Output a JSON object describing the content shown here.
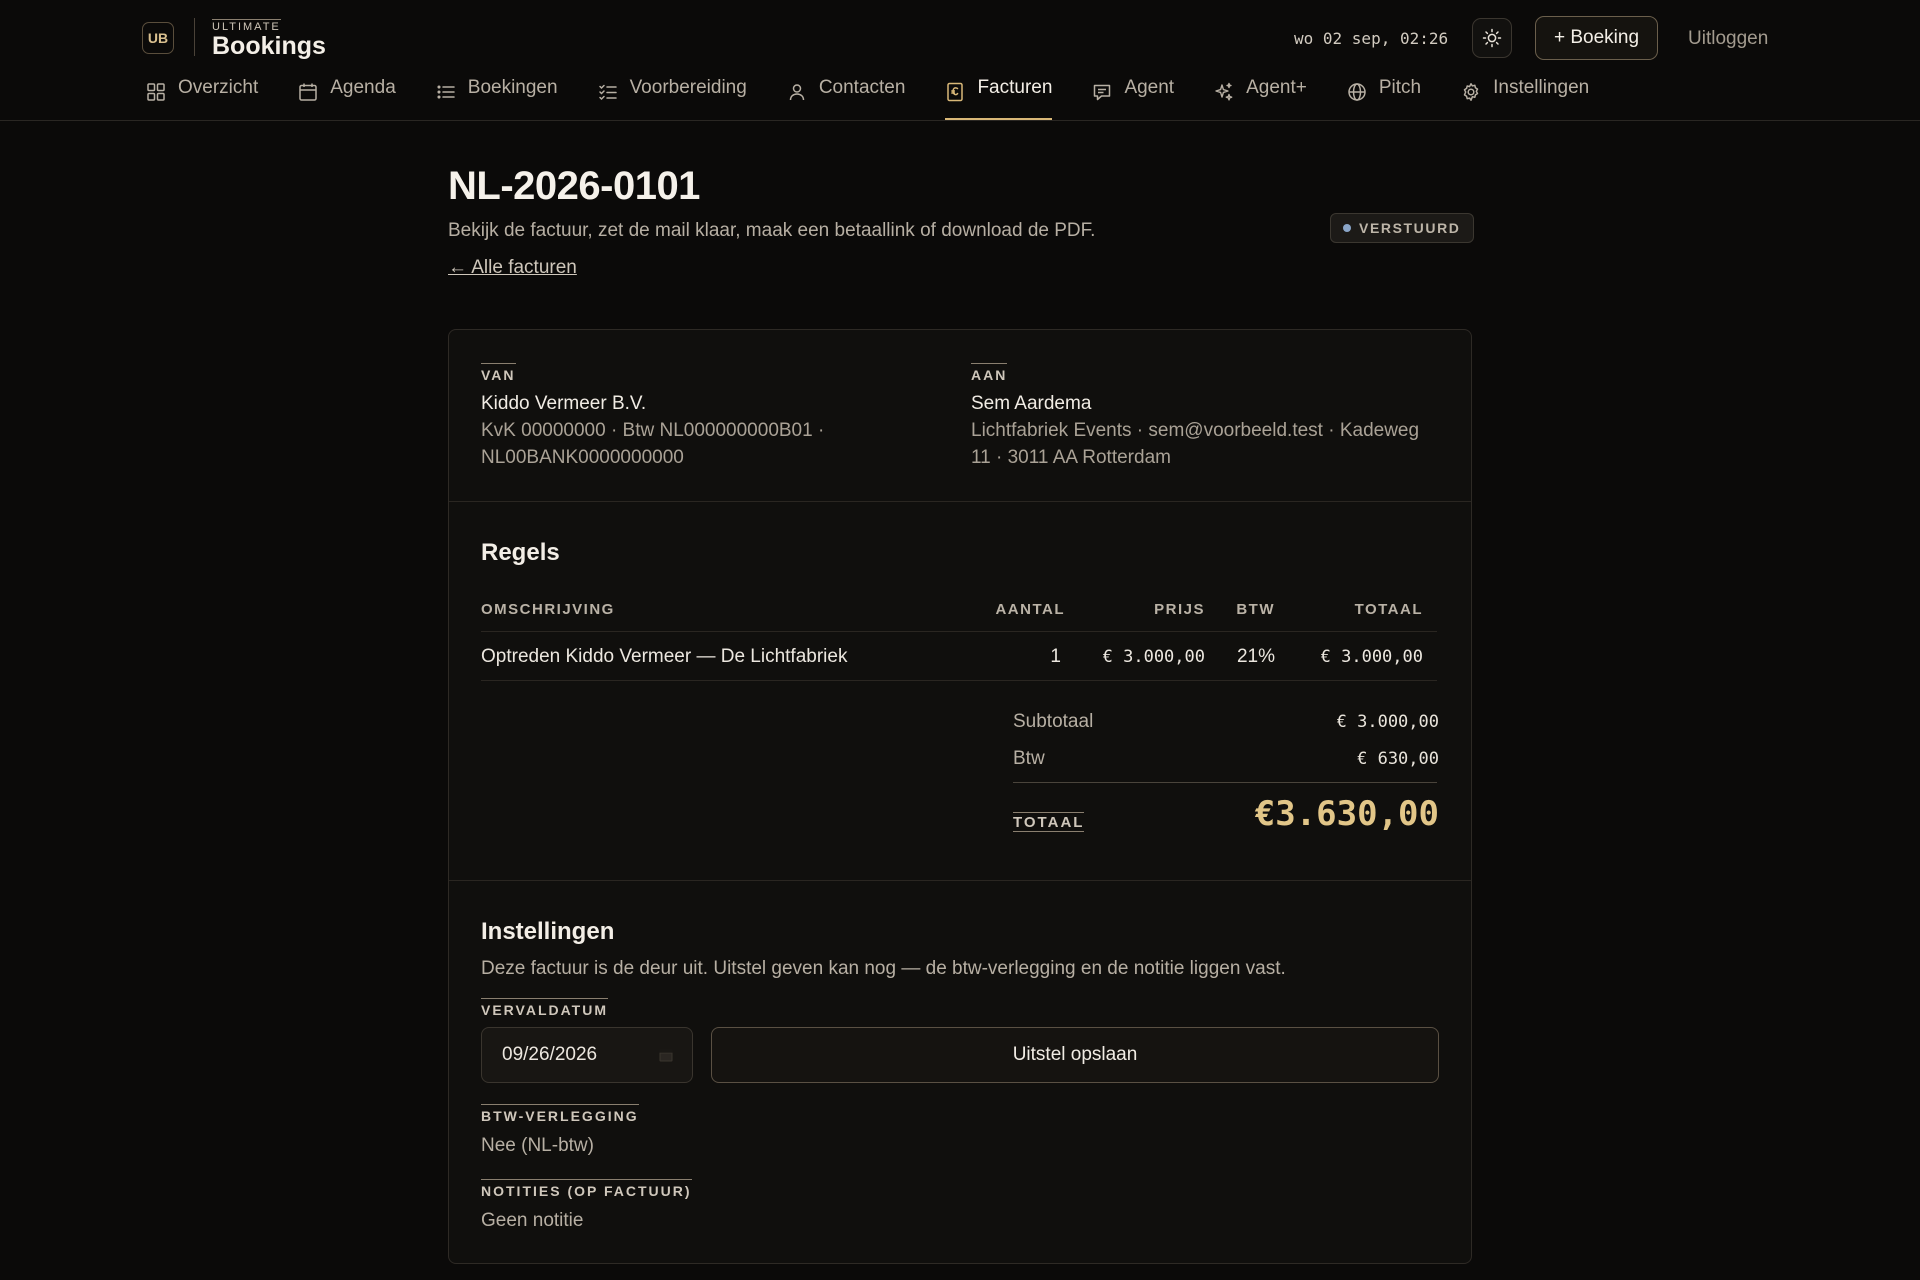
{
  "app": {
    "logo_mark": "UB",
    "brand_small": "ULTIMATE",
    "brand_name": "Bookings",
    "clock": "wo 02 sep, 02:26",
    "new_booking_label": "+ Boeking",
    "logout_label": "Uitloggen"
  },
  "nav": {
    "items": [
      {
        "label": "Overzicht",
        "icon": "grid-icon"
      },
      {
        "label": "Agenda",
        "icon": "calendar-icon"
      },
      {
        "label": "Boekingen",
        "icon": "list-icon"
      },
      {
        "label": "Voorbereiding",
        "icon": "checklist-icon"
      },
      {
        "label": "Contacten",
        "icon": "person-icon"
      },
      {
        "label": "Facturen",
        "icon": "invoice-icon",
        "active": true
      },
      {
        "label": "Agent",
        "icon": "chat-icon"
      },
      {
        "label": "Agent+",
        "icon": "sparkle-icon"
      },
      {
        "label": "Pitch",
        "icon": "globe-icon"
      },
      {
        "label": "Instellingen",
        "icon": "gear-icon"
      }
    ]
  },
  "page": {
    "title": "NL-2026-0101",
    "subtitle": "Bekijk de factuur, zet de mail klaar, maak een betaallink of download de PDF.",
    "back_link": "← Alle facturen",
    "status": "VERSTUURD",
    "status_color": "#8aa5c8"
  },
  "invoice": {
    "from": {
      "label": "VAN",
      "name": "Kiddo Vermeer B.V.",
      "info": "KvK 00000000 · Btw NL000000000B01 · NL00BANK0000000000"
    },
    "to": {
      "label": "AAN",
      "name": "Sem Aardema",
      "info": "Lichtfabriek Events · sem@voorbeeld.test · Kadeweg 11 · 3011 AA Rotterdam"
    },
    "lines_title": "Regels",
    "columns": {
      "description": "OMSCHRIJVING",
      "qty": "AANTAL",
      "price": "PRIJS",
      "vat": "BTW",
      "total": "TOTAAL"
    },
    "rows": [
      {
        "description": "Optreden Kiddo Vermeer — De Lichtfabriek",
        "qty": "1",
        "price": "€ 3.000,00",
        "vat": "21%",
        "total": "€ 3.000,00"
      }
    ],
    "subtotal_label": "Subtotaal",
    "subtotal": "€ 3.000,00",
    "vat_label": "Btw",
    "vat_amount": "€ 630,00",
    "total_label": "TOTAAL",
    "total": "€3.630,00",
    "total_color": "#e2c688"
  },
  "settings": {
    "title": "Instellingen",
    "description": "Deze factuur is de deur uit. Uitstel geven kan nog — de btw-verlegging en de notitie liggen vast.",
    "due_label": "VERVALDATUM",
    "due_value": "09/26/2026",
    "save_label": "Uitstel opslaan",
    "vat_reverse_label": "BTW-VERLEGGING",
    "vat_reverse_value": "Nee (NL-btw)",
    "notes_label": "NOTITIES (OP FACTUUR)",
    "notes_value": "Geen notitie"
  }
}
